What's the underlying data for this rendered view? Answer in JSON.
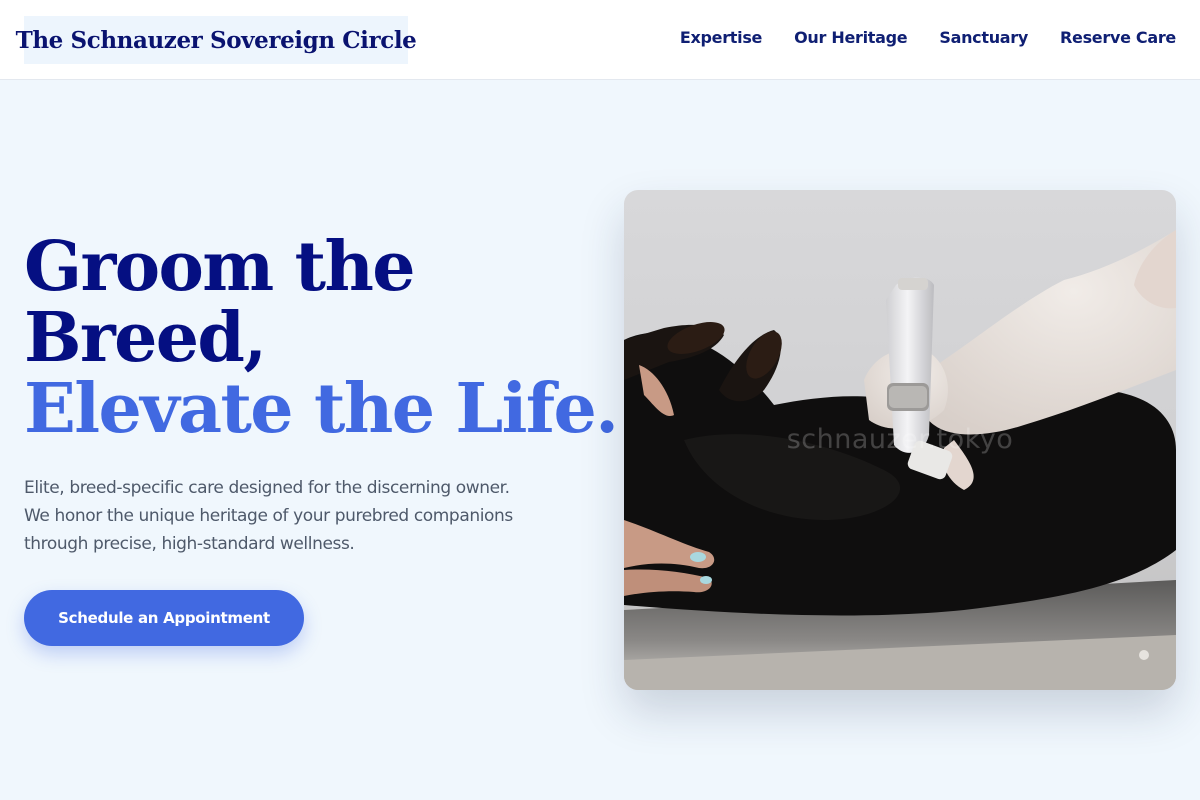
{
  "header": {
    "logo": "The Schnauzer Sovereign Circle",
    "nav": [
      "Expertise",
      "Our Heritage",
      "Sanctuary",
      "Reserve Care"
    ]
  },
  "hero": {
    "title_line1": "Groom the",
    "title_line2": "Breed,",
    "title_accent": "Elevate the Life.",
    "description": "Elite, breed-specific care designed for the discerning owner. We honor the unique heritage of your purebred companions through precise, high-standard wellness.",
    "cta_label": "Schedule an Appointment"
  },
  "image": {
    "watermark": "schnauzer.tokyo"
  },
  "colors": {
    "primary": "#4169e1",
    "navy": "#050f82",
    "background": "#f0f7fd"
  }
}
